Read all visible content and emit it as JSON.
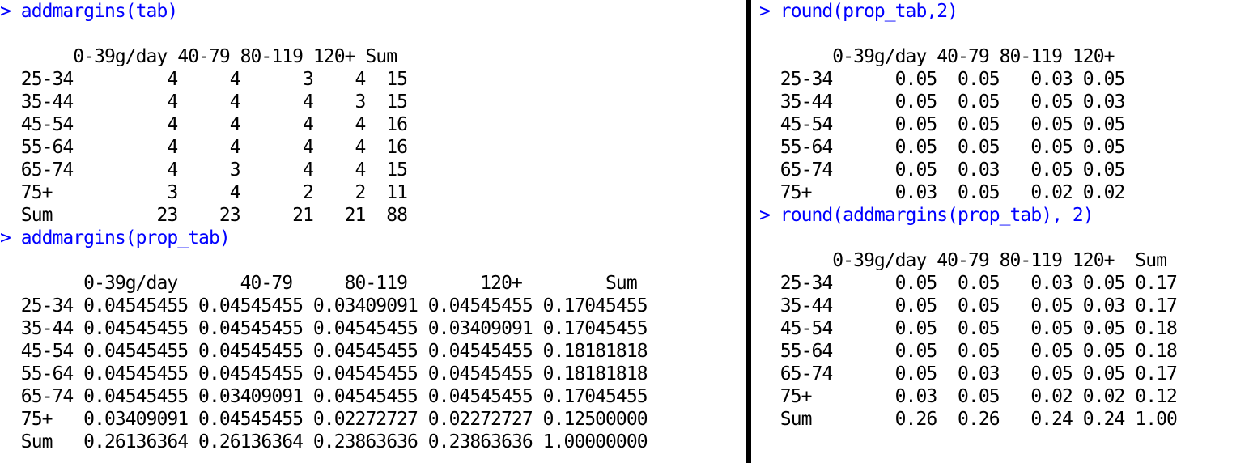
{
  "colors": {
    "command": "#0000ff",
    "output": "#000000",
    "background": "#ffffff",
    "divider": "#000000"
  },
  "left_console": {
    "lines": [
      {
        "type": "command",
        "text": "> addmargins(tab)"
      },
      {
        "type": "output",
        "text": ""
      },
      {
        "type": "output",
        "text": "       0-39g/day 40-79 80-119 120+ Sum"
      },
      {
        "type": "output",
        "text": "  25-34         4     4      3    4  15"
      },
      {
        "type": "output",
        "text": "  35-44         4     4      4    3  15"
      },
      {
        "type": "output",
        "text": "  45-54         4     4      4    4  16"
      },
      {
        "type": "output",
        "text": "  55-64         4     4      4    4  16"
      },
      {
        "type": "output",
        "text": "  65-74         4     3      4    4  15"
      },
      {
        "type": "output",
        "text": "  75+           3     4      2    2  11"
      },
      {
        "type": "output",
        "text": "  Sum          23    23     21   21  88"
      },
      {
        "type": "command",
        "text": "> addmargins(prop_tab)"
      },
      {
        "type": "output",
        "text": ""
      },
      {
        "type": "output",
        "text": "        0-39g/day      40-79     80-119       120+        Sum"
      },
      {
        "type": "output",
        "text": "  25-34 0.04545455 0.04545455 0.03409091 0.04545455 0.17045455"
      },
      {
        "type": "output",
        "text": "  35-44 0.04545455 0.04545455 0.04545455 0.03409091 0.17045455"
      },
      {
        "type": "output",
        "text": "  45-54 0.04545455 0.04545455 0.04545455 0.04545455 0.18181818"
      },
      {
        "type": "output",
        "text": "  55-64 0.04545455 0.04545455 0.04545455 0.04545455 0.18181818"
      },
      {
        "type": "output",
        "text": "  65-74 0.04545455 0.03409091 0.04545455 0.04545455 0.17045455"
      },
      {
        "type": "output",
        "text": "  75+   0.03409091 0.04545455 0.02272727 0.02272727 0.12500000"
      },
      {
        "type": "output",
        "text": "  Sum   0.26136364 0.26136364 0.23863636 0.23863636 1.00000000"
      }
    ]
  },
  "right_console": {
    "lines": [
      {
        "type": "command",
        "text": "> round(prop_tab,2)"
      },
      {
        "type": "output",
        "text": ""
      },
      {
        "type": "output",
        "text": "       0-39g/day 40-79 80-119 120+"
      },
      {
        "type": "output",
        "text": "  25-34      0.05  0.05   0.03 0.05"
      },
      {
        "type": "output",
        "text": "  35-44      0.05  0.05   0.05 0.03"
      },
      {
        "type": "output",
        "text": "  45-54      0.05  0.05   0.05 0.05"
      },
      {
        "type": "output",
        "text": "  55-64      0.05  0.05   0.05 0.05"
      },
      {
        "type": "output",
        "text": "  65-74      0.05  0.03   0.05 0.05"
      },
      {
        "type": "output",
        "text": "  75+        0.03  0.05   0.02 0.02"
      },
      {
        "type": "command",
        "text": "> round(addmargins(prop_tab), 2)"
      },
      {
        "type": "output",
        "text": ""
      },
      {
        "type": "output",
        "text": "       0-39g/day 40-79 80-119 120+  Sum"
      },
      {
        "type": "output",
        "text": "  25-34      0.05  0.05   0.03 0.05 0.17"
      },
      {
        "type": "output",
        "text": "  35-44      0.05  0.05   0.05 0.03 0.17"
      },
      {
        "type": "output",
        "text": "  45-54      0.05  0.05   0.05 0.05 0.18"
      },
      {
        "type": "output",
        "text": "  55-64      0.05  0.05   0.05 0.05 0.18"
      },
      {
        "type": "output",
        "text": "  65-74      0.05  0.03   0.05 0.05 0.17"
      },
      {
        "type": "output",
        "text": "  75+        0.03  0.05   0.02 0.02 0.12"
      },
      {
        "type": "output",
        "text": "  Sum        0.26  0.26   0.24 0.24 1.00"
      }
    ]
  }
}
